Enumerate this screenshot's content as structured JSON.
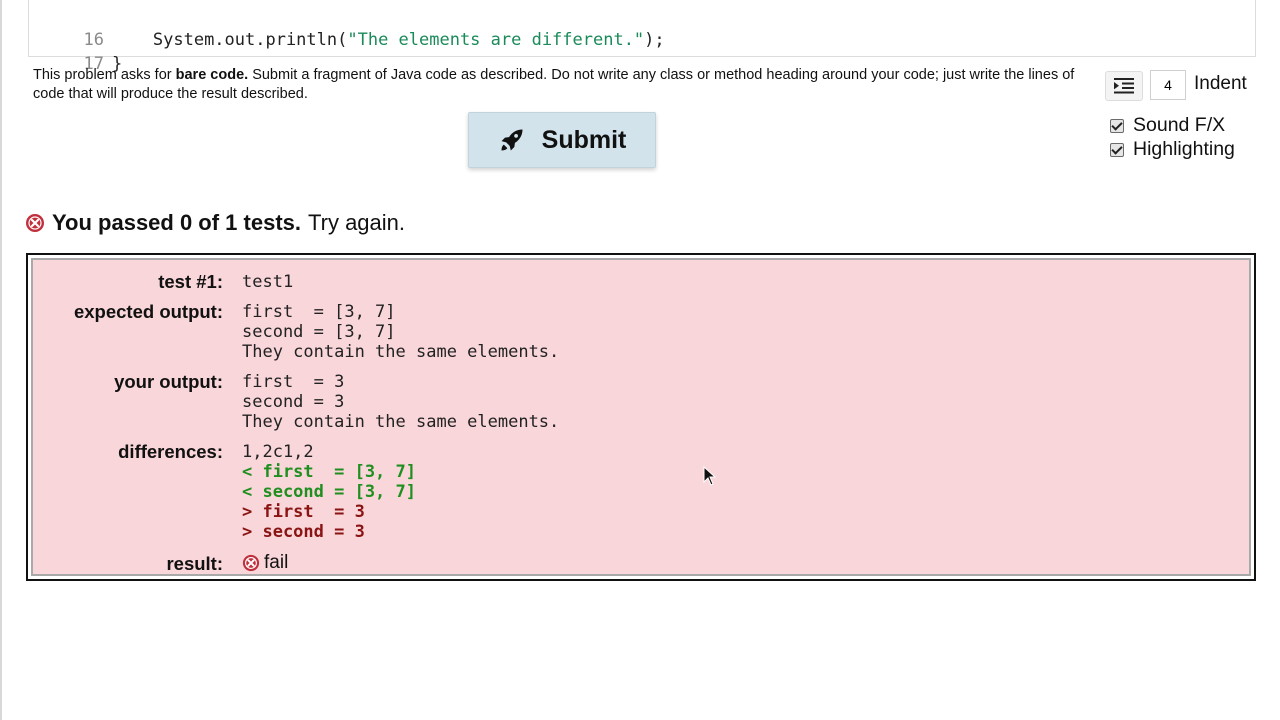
{
  "editor": {
    "lines": [
      {
        "num": "16",
        "code_pre": "    System.out.println(",
        "code_str": "\"The elements are different.\"",
        "code_post": ");"
      },
      {
        "num": "17",
        "code_pre": "}",
        "code_str": "",
        "code_post": ""
      }
    ]
  },
  "instructions": {
    "part1": "This problem asks for ",
    "bold1": "bare code.",
    "part2": " Submit a fragment of Java code as described. Do not write any class or method heading around your code; just write the lines of code that will produce the result described."
  },
  "submit": {
    "label": "Submit",
    "icon": "rocket-icon"
  },
  "controls": {
    "indent_value": "4",
    "indent_label": "Indent",
    "sound_label": "Sound F/X",
    "sound_checked": true,
    "highlighting_label": "Highlighting",
    "highlighting_checked": true
  },
  "status": {
    "bold": "You passed 0 of 1 tests.",
    "rest": " Try again."
  },
  "result": {
    "test_label": "test #1:",
    "test_value": "test1",
    "expected_label": "expected output:",
    "expected_lines": [
      "first  = [3, 7]",
      "second = [3, 7]",
      "They contain the same elements."
    ],
    "your_label": "your output:",
    "your_lines": [
      "first  = 3",
      "second = 3",
      "They contain the same elements."
    ],
    "differences_label": "differences:",
    "diff_header": "1,2c1,2",
    "diff_lines": [
      {
        "type": "del",
        "text": "< first  = [3, 7]"
      },
      {
        "type": "del",
        "text": "< second = [3, 7]"
      },
      {
        "type": "add",
        "text": "> first  = 3"
      },
      {
        "type": "add",
        "text": "> second = 3"
      }
    ],
    "result_label": "result:",
    "result_value": "fail"
  },
  "colors": {
    "fail_red": "#c0313d",
    "result_bg": "#f9d6da",
    "diff_removed": "#1f8f1f",
    "diff_added": "#8a1414",
    "submit_bg": "#d3e3ec"
  }
}
